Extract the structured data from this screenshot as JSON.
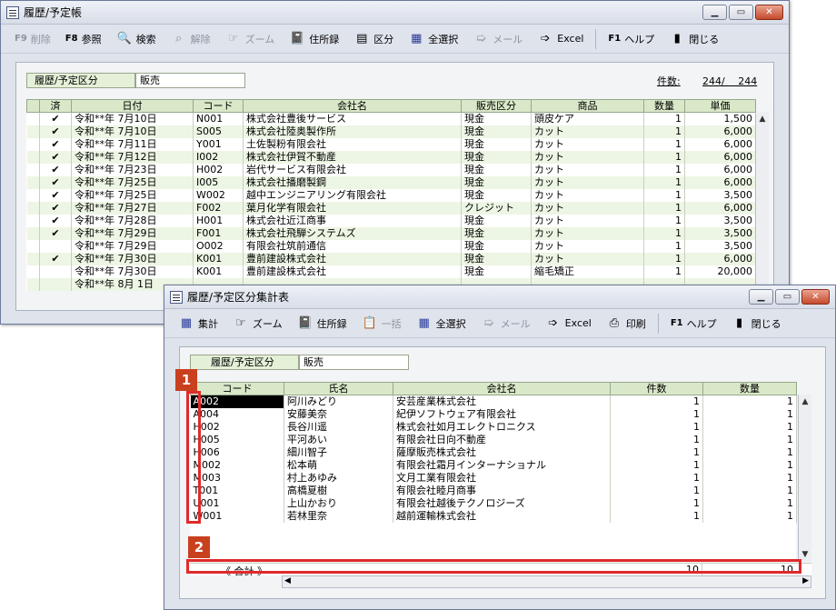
{
  "win1": {
    "title": "履歴/予定帳",
    "toolbar": {
      "f9_key": "F9",
      "delete_label": "削除",
      "f8_key": "F8",
      "ref_label": "参照",
      "search_label": "検索",
      "release_label": "解除",
      "zoom_label": "ズーム",
      "address_label": "住所録",
      "section_label": "区分",
      "select_all_label": "全選択",
      "mail_label": "メール",
      "excel_label": "Excel",
      "f1_key": "F1",
      "help_label": "ヘルプ",
      "close_label": "閉じる"
    },
    "category_label": "履歴/予定区分",
    "category_value": "販売",
    "count_label": "件数:",
    "count_value": "244/　 244",
    "headers": [
      "済",
      "日付",
      "コード",
      "会社名",
      "販売区分",
      "商品",
      "数量",
      "単価"
    ],
    "rows": [
      [
        "✔",
        "令和**年 7月10日",
        "N001",
        "株式会社豊後サービス",
        "現金",
        "頭皮ケア",
        "1",
        "1,500"
      ],
      [
        "✔",
        "令和**年 7月10日",
        "S005",
        "株式会社陸奥製作所",
        "現金",
        "カット",
        "1",
        "6,000"
      ],
      [
        "✔",
        "令和**年 7月11日",
        "Y001",
        "土佐製粉有限会社",
        "現金",
        "カット",
        "1",
        "6,000"
      ],
      [
        "✔",
        "令和**年 7月12日",
        "I002",
        "株式会社伊賀不動産",
        "現金",
        "カット",
        "1",
        "6,000"
      ],
      [
        "✔",
        "令和**年 7月23日",
        "H002",
        "岩代サービス有限会社",
        "現金",
        "カット",
        "1",
        "6,000"
      ],
      [
        "✔",
        "令和**年 7月25日",
        "I005",
        "株式会社播磨製鋼",
        "現金",
        "カット",
        "1",
        "6,000"
      ],
      [
        "✔",
        "令和**年 7月25日",
        "W002",
        "越中エンジニアリング有限会社",
        "現金",
        "カット",
        "1",
        "3,500"
      ],
      [
        "✔",
        "令和**年 7月27日",
        "F002",
        "葉月化学有限会社",
        "クレジット",
        "カット",
        "1",
        "6,000"
      ],
      [
        "✔",
        "令和**年 7月28日",
        "H001",
        "株式会社近江商事",
        "現金",
        "カット",
        "1",
        "3,500"
      ],
      [
        "✔",
        "令和**年 7月29日",
        "F001",
        "株式会社飛騨システムズ",
        "現金",
        "カット",
        "1",
        "3,500"
      ],
      [
        "",
        "令和**年 7月29日",
        "O002",
        "有限会社筑前通信",
        "現金",
        "カット",
        "1",
        "3,500"
      ],
      [
        "✔",
        "令和**年 7月30日",
        "K001",
        "豊前建設株式会社",
        "現金",
        "カット",
        "1",
        "6,000"
      ],
      [
        "",
        "令和**年 7月30日",
        "K001",
        "豊前建設株式会社",
        "現金",
        "縮毛矯正",
        "1",
        "20,000"
      ],
      [
        "",
        "令和**年 8月 1日",
        "",
        "",
        "",
        "",
        "",
        ""
      ]
    ]
  },
  "win2": {
    "title": "履歴/予定区分集計表",
    "toolbar": {
      "sum_label": "集計",
      "zoom_label": "ズーム",
      "address_label": "住所録",
      "bulk_label": "一括",
      "select_all_label": "全選択",
      "mail_label": "メール",
      "excel_label": "Excel",
      "print_label": "印刷",
      "f1_key": "F1",
      "help_label": "ヘルプ",
      "close_label": "閉じる"
    },
    "category_label": "履歴/予定区分",
    "category_value": "販売",
    "headers": [
      "コード",
      "氏名",
      "会社名",
      "件数",
      "数量"
    ],
    "rows": [
      [
        "A002",
        "阿川みどり",
        "安芸産業株式会社",
        "1",
        "1"
      ],
      [
        "A004",
        "安藤美奈",
        "紀伊ソフトウェア有限会社",
        "1",
        "1"
      ],
      [
        "H002",
        "長谷川遥",
        "株式会社如月エレクトロニクス",
        "1",
        "1"
      ],
      [
        "H005",
        "平河あい",
        "有限会社日向不動産",
        "1",
        "1"
      ],
      [
        "H006",
        "細川智子",
        "薩摩販売株式会社",
        "1",
        "1"
      ],
      [
        "M002",
        "松本萌",
        "有限会社霜月インターナショナル",
        "1",
        "1"
      ],
      [
        "M003",
        "村上あゆみ",
        "文月工業有限会社",
        "1",
        "1"
      ],
      [
        "T001",
        "高橋夏樹",
        "有限会社睦月商事",
        "1",
        "1"
      ],
      [
        "U001",
        "上山かおり",
        "有限会社越後テクノロジーズ",
        "1",
        "1"
      ],
      [
        "W001",
        "若林里奈",
        "越前運輸株式会社",
        "1",
        "1"
      ]
    ],
    "total_label": "《 合計 》",
    "total_count": "10",
    "total_qty": "10"
  },
  "badges": {
    "b1": "1",
    "b2": "2"
  },
  "colors": {
    "highlight": "#e02a2a",
    "badge": "#c9401f",
    "header_green": "#d9e8c8"
  }
}
